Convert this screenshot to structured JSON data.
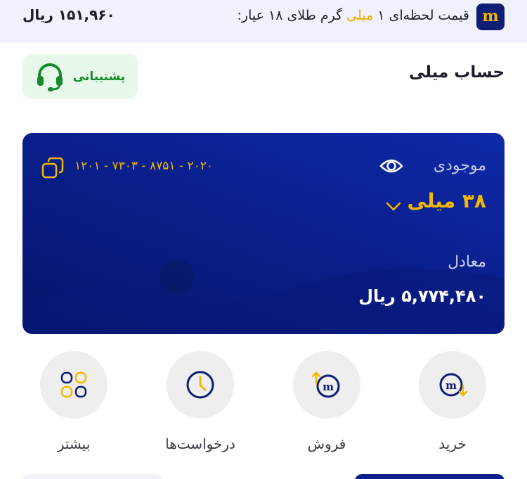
{
  "price_bar": {
    "logo_letter": "m",
    "label_prefix": "قیمت لحظه‌ای ۱",
    "label_highlight": "میلی",
    "label_suffix": "گرم طلای ۱۸ عیار:",
    "value": "۱۵۱,۹۶۰ ریال"
  },
  "header": {
    "title": "حساب میلی",
    "support_label": "پشتیبانی",
    "support_icon": "headset-icon"
  },
  "account_card": {
    "balance_label": "موجودی",
    "balance_value": "۳۸ میلی",
    "account_number": "۲۰۲۰ - ۸۷۵۱ - ۷۳۰۳ - ۱۲۰۱",
    "equivalent_label": "معادل",
    "equivalent_value": "۵,۷۷۴,۴۸۰ ریال",
    "eye_icon": "eye-icon",
    "copy_icon": "copy-icon",
    "chevron_icon": "chevron-down-icon"
  },
  "actions": [
    {
      "label": "خرید",
      "icon": "buy-icon"
    },
    {
      "label": "فروش",
      "icon": "sell-icon"
    },
    {
      "label": "درخواست‌ها",
      "icon": "clock-icon"
    },
    {
      "label": "بیشتر",
      "icon": "grid-icon"
    }
  ],
  "colors": {
    "brand_navy": "#0a1f8d",
    "gold": "#f5b800",
    "support_green": "#148a2a",
    "support_bg": "#e7f8ea"
  }
}
